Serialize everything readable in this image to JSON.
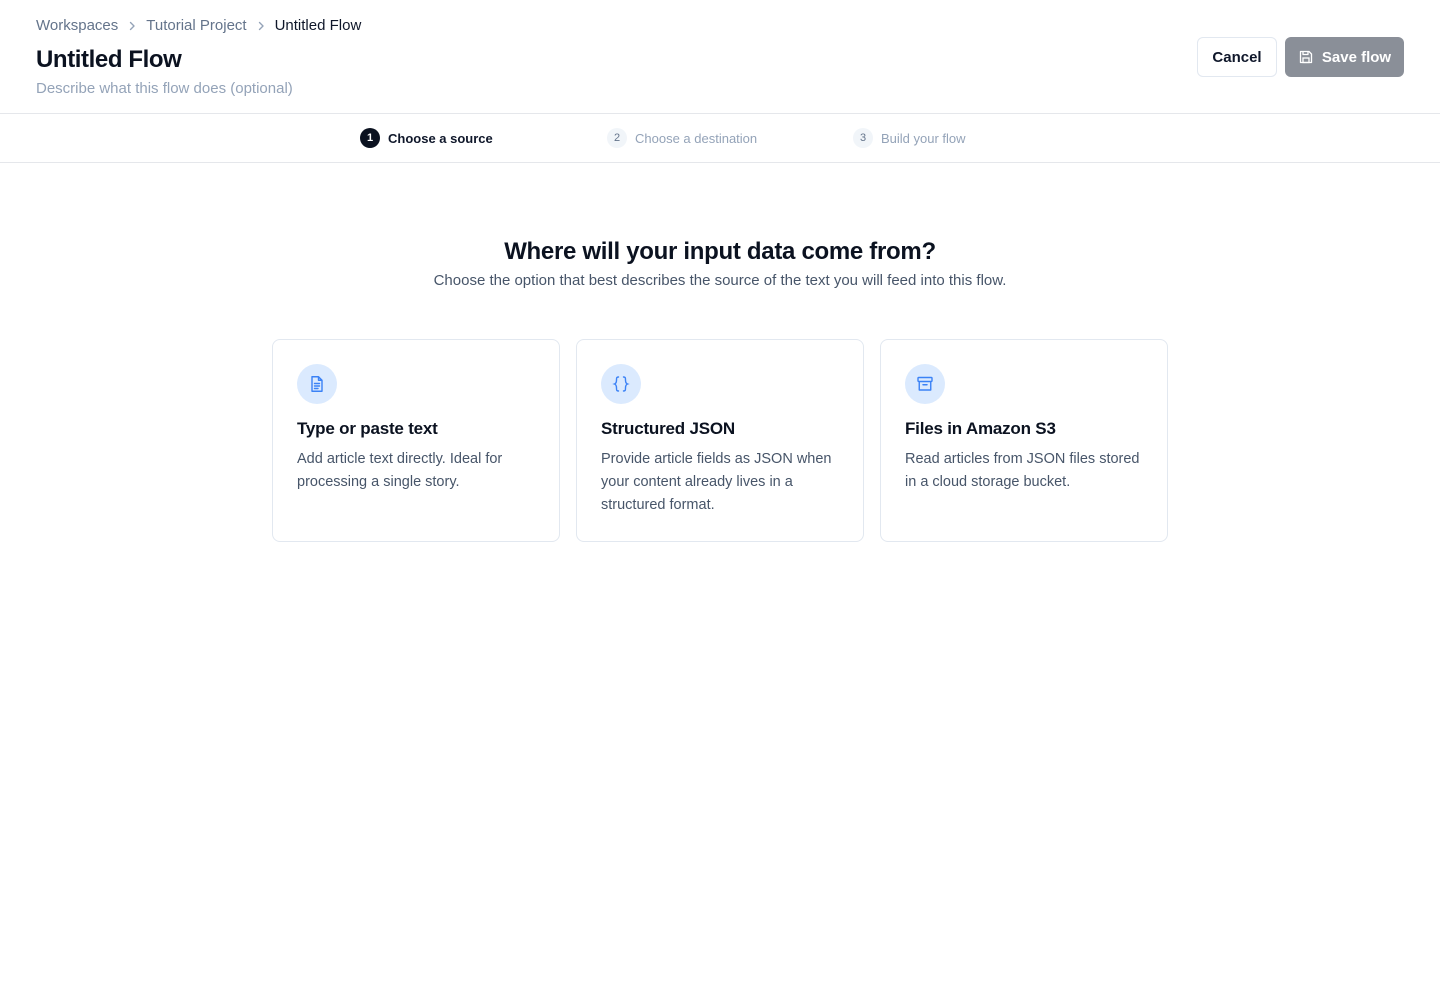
{
  "breadcrumb": {
    "items": [
      "Workspaces",
      "Tutorial Project",
      "Untitled Flow"
    ]
  },
  "header": {
    "title": "Untitled Flow",
    "description_placeholder": "Describe what this flow does (optional)",
    "description_value": "",
    "cancel_label": "Cancel",
    "save_label": "Save flow",
    "save_icon": "save-icon"
  },
  "steps": [
    {
      "number": "1",
      "label": "Choose a source",
      "state": "active"
    },
    {
      "number": "2",
      "label": "Choose a destination",
      "state": "inactive"
    },
    {
      "number": "3",
      "label": "Build your flow",
      "state": "inactive"
    }
  ],
  "main": {
    "heading": "Where will your input data come from?",
    "subheading": "Choose the option that best describes the source of the text you will feed into this flow."
  },
  "options": [
    {
      "icon": "file-text-icon",
      "title": "Type or paste text",
      "description": "Add article text directly. Ideal for processing a single story."
    },
    {
      "icon": "braces-icon",
      "title": "Structured JSON",
      "description": "Provide article fields as JSON when your content already lives in a structured format."
    },
    {
      "icon": "archive-icon",
      "title": "Files in Amazon S3",
      "description": "Read articles from JSON files stored in a cloud storage bucket."
    }
  ],
  "colors": {
    "accent_icon": "#3b82f6",
    "icon_bg": "#dbeafe",
    "save_button_bg": "#8a8f98",
    "active_step": "#0b1220"
  }
}
